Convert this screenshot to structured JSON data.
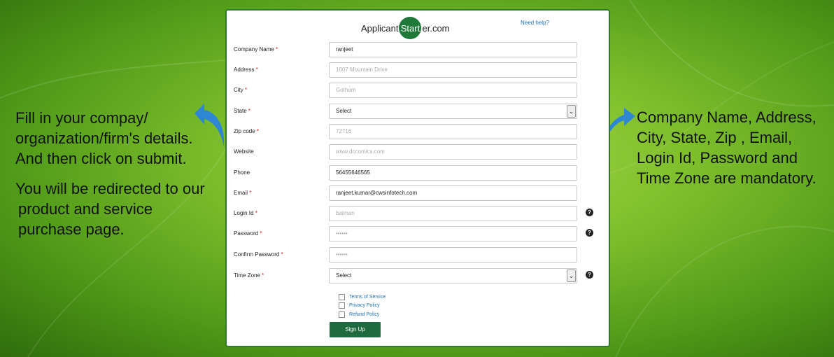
{
  "left_text": {
    "line1": "Fill in your compay/",
    "line2": "organization/firm's details.",
    "line3": "And then click on submit.",
    "line4": "You will be redirected to our",
    "line5": "product and service",
    "line6": "purchase page."
  },
  "right_text": {
    "line1": "Company Name, Address,",
    "line2": "City, State, Zip , Email,",
    "line3": "Login Id, Password and",
    "line4": "Time Zone are mandatory."
  },
  "header": {
    "logo_left": "Applicant",
    "logo_circle": "Start",
    "logo_right": "er.com",
    "help_link": "Need help?"
  },
  "form": {
    "required_marker": "*",
    "company_name": {
      "label": "Company Name",
      "value": "ranjeet"
    },
    "address": {
      "label": "Address",
      "placeholder": "1007 Mountain Drive"
    },
    "city": {
      "label": "City",
      "placeholder": "Gotham"
    },
    "state": {
      "label": "State",
      "selected": "Select"
    },
    "zip": {
      "label": "Zip code",
      "placeholder": "72716"
    },
    "website": {
      "label": "Website",
      "placeholder": "www.dccomics.com"
    },
    "phone": {
      "label": "Phone",
      "value": "56455646565"
    },
    "email": {
      "label": "Email",
      "value": "ranjeet.kumar@cwsinfotech.com"
    },
    "login_id": {
      "label": "Login Id",
      "placeholder": "batman"
    },
    "password": {
      "label": "Password",
      "placeholder": "••••••"
    },
    "confirm_password": {
      "label": "Confirm Password",
      "placeholder": "••••••"
    },
    "time_zone": {
      "label": "Time Zone",
      "selected": "Select"
    },
    "terms": "Terms of Service",
    "privacy": "Privacy Policy",
    "refund": "Refund Policy",
    "submit": "Sign Up",
    "help_glyph": "?",
    "chevron_glyph": "⌄"
  },
  "colors": {
    "accent_green": "#1f6b3f",
    "link_blue": "#1a6fb5",
    "required_red": "#d11111",
    "arrow_blue": "#2f86d4"
  },
  "icons": [
    "help-question-icon",
    "chevron-down-icon",
    "curved-arrow-icon"
  ]
}
